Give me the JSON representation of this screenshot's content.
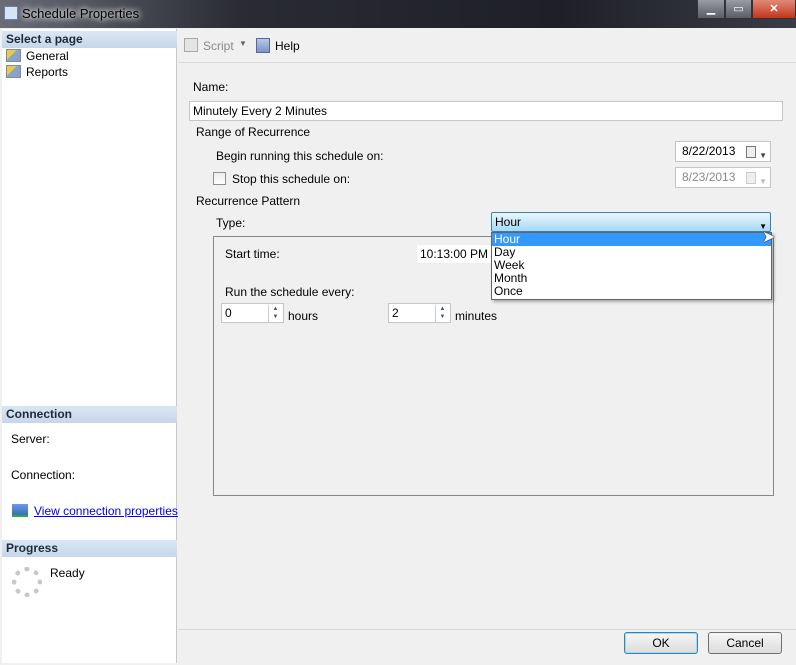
{
  "window": {
    "title": "Schedule Properties"
  },
  "sidebar": {
    "select_page": "Select a page",
    "pages": [
      {
        "label": "General"
      },
      {
        "label": "Reports"
      }
    ],
    "connection_header": "Connection",
    "server_label": "Server:",
    "connection_label": "Connection:",
    "view_connection_link": "View connection properties",
    "progress_header": "Progress",
    "progress_status": "Ready"
  },
  "toolbar": {
    "script_label": "Script",
    "help_label": "Help"
  },
  "form": {
    "name_label": "Name:",
    "name_value": "Minutely Every 2 Minutes",
    "range_header": "Range of Recurrence",
    "begin_label": "Begin running this schedule on:",
    "begin_date": "8/22/2013",
    "stop_label": "Stop this schedule on:",
    "stop_checked": false,
    "stop_date": "8/23/2013",
    "pattern_header": "Recurrence Pattern",
    "type_label": "Type:",
    "type_value": "Hour",
    "type_options": [
      "Hour",
      "Day",
      "Week",
      "Month",
      "Once"
    ],
    "start_time_label": "Start time:",
    "start_time": "10:13:00 PM",
    "run_every_label": "Run the schedule every:",
    "hours_value": "0",
    "hours_label": "hours",
    "minutes_value": "2",
    "minutes_label": "minutes"
  },
  "footer": {
    "ok": "OK",
    "cancel": "Cancel"
  }
}
